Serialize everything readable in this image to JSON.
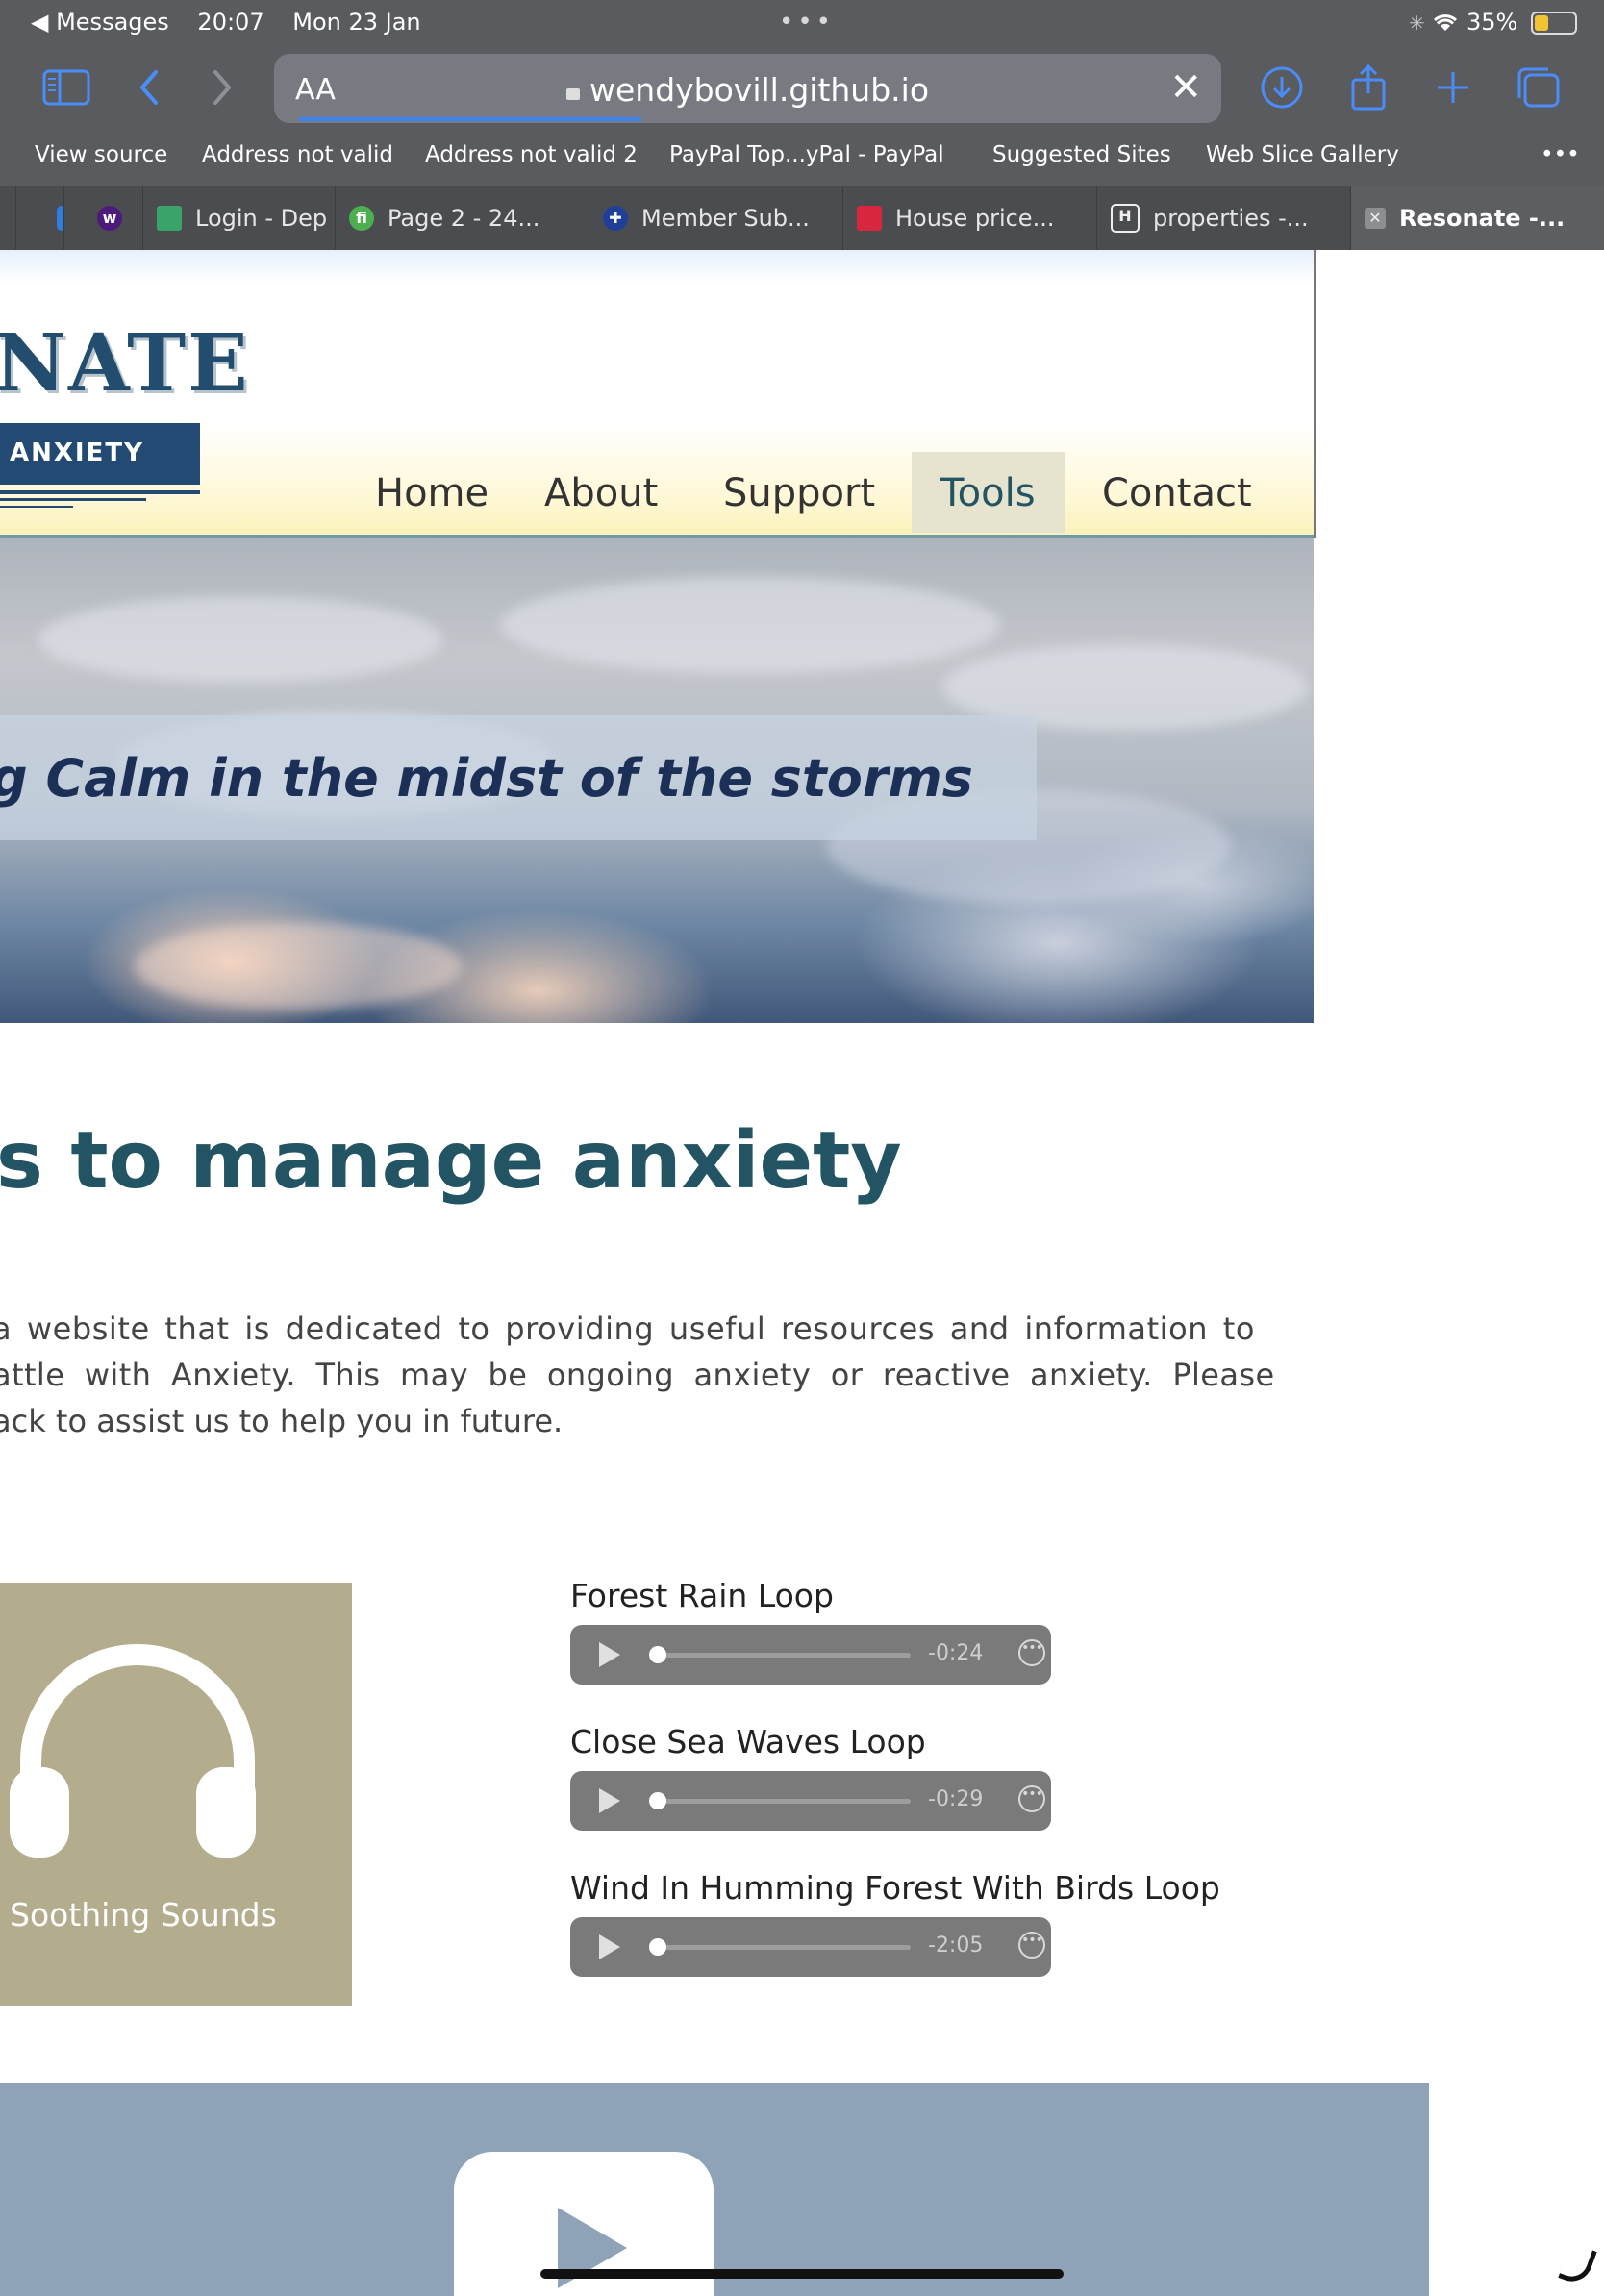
{
  "status_bar": {
    "back_app": "◀ Messages",
    "time": "20:07",
    "date": "Mon 23 Jan",
    "battery": "35%"
  },
  "toolbar": {
    "reader_label": "AA",
    "host": "wendybovill.github.io",
    "close": "✕"
  },
  "favorites": [
    "View source",
    "Address not valid",
    "Address not valid 2",
    "PayPal Top...yPal - PayPal",
    "Suggested Sites",
    "Web Slice Gallery"
  ],
  "more_menu": "•••",
  "tabs": [
    {
      "label": "Login - Dep"
    },
    {
      "label": "Page 2 - 24..."
    },
    {
      "label": "Member Sub..."
    },
    {
      "label": "House price..."
    },
    {
      "label": "properties -..."
    },
    {
      "label": "Resonate -..."
    }
  ],
  "site": {
    "logo_title": "NATE",
    "logo_band": "ANXIETY",
    "nav": [
      "Home",
      "About",
      "Support",
      "Tools",
      "Contact"
    ],
    "active_nav": "Tools",
    "tagline": "g Calm in the midst of the storms",
    "heading": "s to manage anxiety",
    "intro_lines": [
      "a website that is dedicated to providing useful resources and information to",
      "attle with Anxiety. This may be ongoing anxiety or reactive anxiety. Please",
      "ack to assist us to help you in future."
    ],
    "sounds_card_label": "Soothing Sounds",
    "tracks": [
      {
        "name": "Forest Rain Loop",
        "remaining": "-0:24"
      },
      {
        "name": "Close Sea Waves Loop",
        "remaining": "-0:29"
      },
      {
        "name": "Wind In Humming Forest With Birds Loop",
        "remaining": "-2:05"
      }
    ]
  },
  "colors": {
    "chrome": "#5a5b5e",
    "accent_blue": "#3b82f6",
    "heading_teal": "#225463",
    "logo_navy": "#234a73",
    "card_khaki": "#b3ad8e",
    "video_panel": "#8ea3b8"
  }
}
